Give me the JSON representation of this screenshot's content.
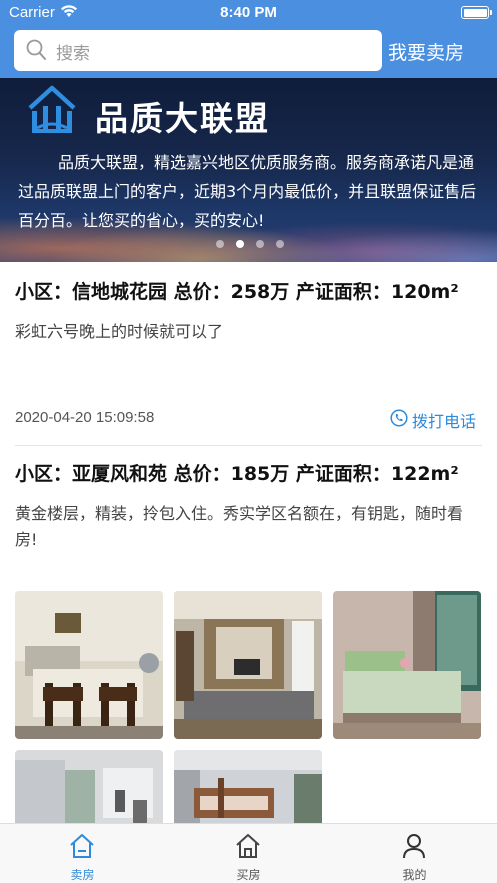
{
  "status_bar": {
    "carrier": "Carrier",
    "time": "8:40 PM"
  },
  "header": {
    "search_placeholder": "搜索",
    "sell_button": "我要卖房",
    "accent_color": "#4a8fe0"
  },
  "banner": {
    "title": "品质大联盟",
    "text": "品质大联盟，精选嘉兴地区优质服务商。服务商承诺凡是通过品质联盟上门的客户，近期3个月内最低价，并且联盟保证售后百分百。让您买的省心，买的安心!",
    "slides": 4,
    "active_slide": 2
  },
  "listings": [
    {
      "title": "小区：信地城花园 总价：258万 产证面积：120m²",
      "description": "彩虹六号晚上的时候就可以了",
      "date": "2020-04-20 15:09:58",
      "call_label": "拨打电话"
    },
    {
      "title": "小区：亚厦风和苑 总价：185万 产证面积：122m²",
      "description": "黄金楼层，精装，拎包入住。秀实学区名额在，有钥匙，随时看房!",
      "photos": [
        "dining-room-photo",
        "living-room-photo",
        "bedroom-photo",
        "bathroom-photo",
        "bunk-bed-room-photo"
      ]
    }
  ],
  "tabbar": {
    "tabs": [
      {
        "label": "卖房",
        "icon": "house-icon",
        "active": true
      },
      {
        "label": "买房",
        "icon": "house-icon",
        "active": false
      },
      {
        "label": "我的",
        "icon": "person-icon",
        "active": false
      }
    ],
    "active_color": "#2f8ad9"
  }
}
